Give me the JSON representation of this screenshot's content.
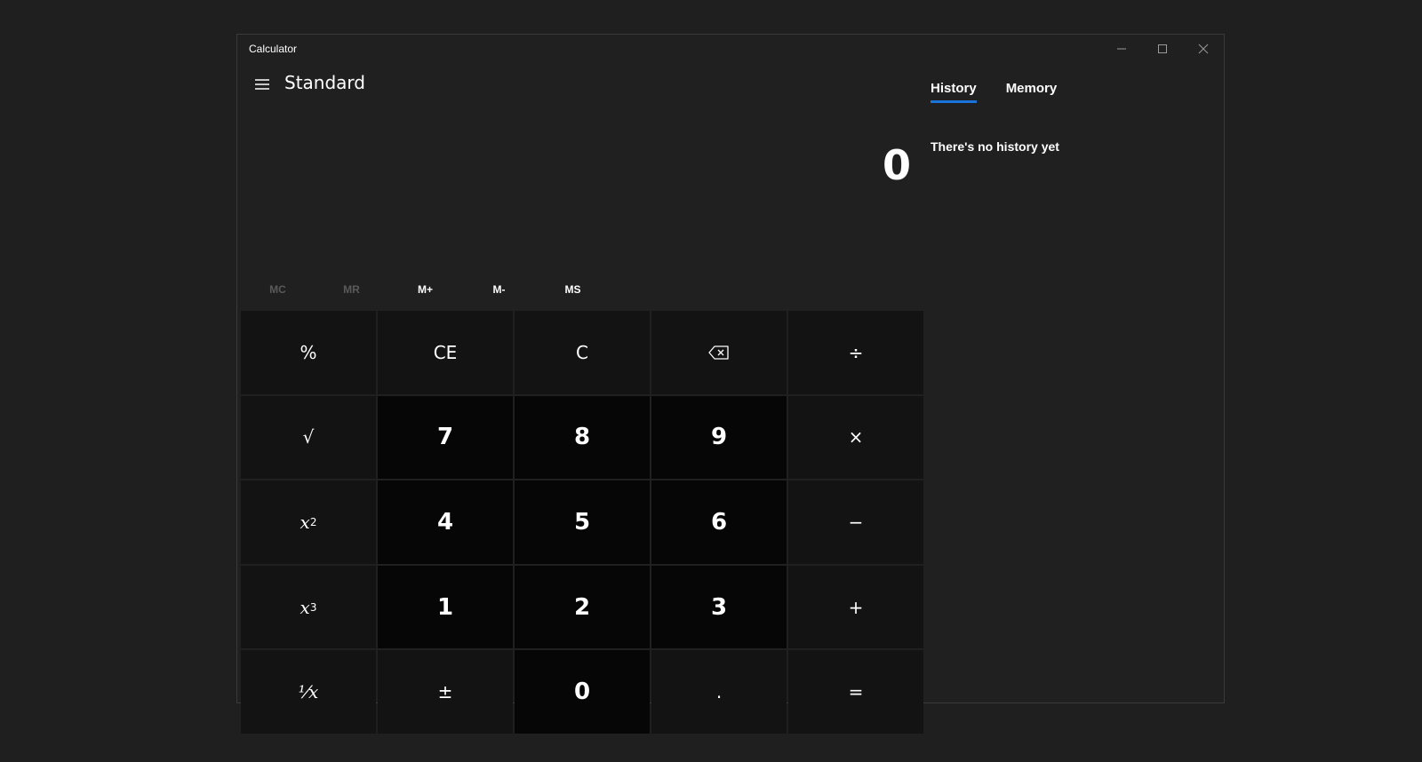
{
  "window": {
    "title": "Calculator"
  },
  "header": {
    "mode": "Standard"
  },
  "display": {
    "value": "0"
  },
  "memory_buttons": [
    {
      "label": "MC",
      "enabled": false
    },
    {
      "label": "MR",
      "enabled": false
    },
    {
      "label": "M+",
      "enabled": true
    },
    {
      "label": "M-",
      "enabled": true
    },
    {
      "label": "MS",
      "enabled": true
    }
  ],
  "keys": {
    "percent": "%",
    "clear_entry": "CE",
    "clear": "C",
    "divide": "÷",
    "sqrt": "√",
    "seven": "7",
    "eight": "8",
    "nine": "9",
    "multiply": "×",
    "square_base": "x",
    "square_exp": "2",
    "four": "4",
    "five": "5",
    "six": "6",
    "minus": "−",
    "cube_base": "x",
    "cube_exp": "3",
    "one": "1",
    "two": "2",
    "three": "3",
    "plus": "+",
    "reciprocal": "⅟x",
    "negate": "±",
    "zero": "0",
    "decimal": ".",
    "equals": "="
  },
  "side_panel": {
    "tabs": [
      {
        "label": "History",
        "active": true
      },
      {
        "label": "Memory",
        "active": false
      }
    ],
    "empty_message": "There's no history yet"
  },
  "colors": {
    "background": "#1f1f1f",
    "window": "#202020",
    "operator_key": "#131313",
    "number_key": "#060606",
    "accent": "#1a73d9",
    "disabled_text": "#5a5a5a"
  },
  "icons": {
    "menu": "hamburger-icon",
    "backspace": "backspace-icon",
    "minimize": "minimize-icon",
    "maximize": "maximize-icon",
    "close": "close-icon"
  }
}
